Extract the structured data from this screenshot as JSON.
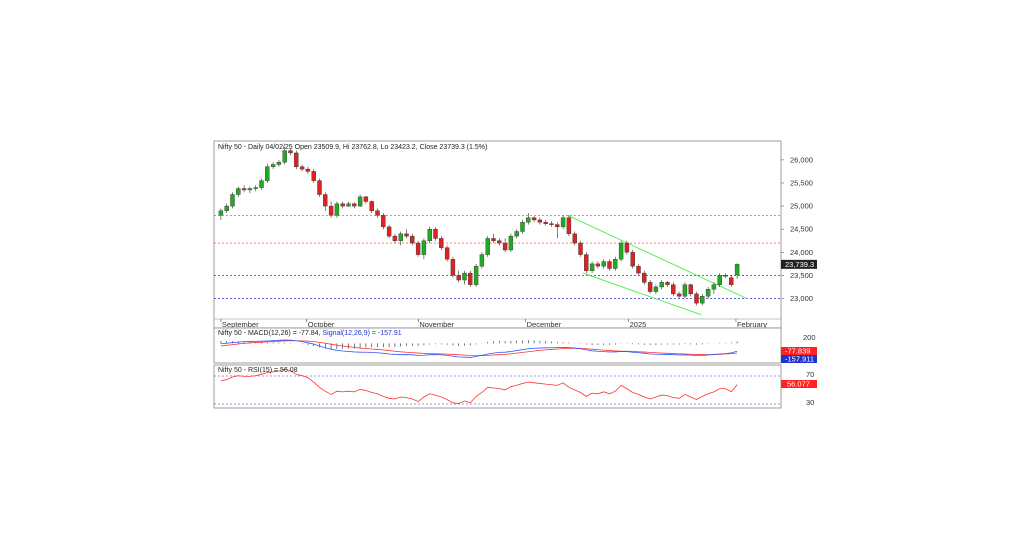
{
  "colors": {
    "up": "#22aa22",
    "down": "#dd2222",
    "channel": "#44ee44",
    "resistance": "#ff3333",
    "support": "#3333cc",
    "macd": "#3355ff",
    "signal": "#ff3333",
    "rsi": "#ff3333",
    "price_label_bg": "#222222",
    "macd_label_bg": "#ff2222",
    "signal_label_bg": "#2233cc"
  },
  "chart_data": [
    {
      "type": "candlestick",
      "title": "Nifty 50 - Daily 04/02/25 Open 23509.9, Hi 23762.8, Lo 23423.2, Close 23739.3 (1.5%)",
      "months": [
        {
          "label": "September",
          "index": 0
        },
        {
          "label": "October",
          "index": 20
        },
        {
          "label": "November",
          "index": 46
        },
        {
          "label": "December",
          "index": 71
        },
        {
          "label": "2025",
          "index": 95
        },
        {
          "label": "February",
          "index": 120
        }
      ],
      "ylim": [
        22600,
        26300
      ],
      "yticks": [
        23000,
        23500,
        24000,
        24500,
        25000,
        25500,
        26000
      ],
      "ytick_labels": [
        "23,000",
        "23,500",
        "24,000",
        "24,500",
        "25,000",
        "25,500",
        "26,000"
      ],
      "last_price_label": "23,739.3",
      "resistance_levels": [
        24800,
        24200
      ],
      "support_levels": [
        23500,
        23000
      ],
      "channel_lines": [
        {
          "x0": 91,
          "y0": 24800,
          "x1": 138,
          "y1": 23000
        },
        {
          "x0": 95,
          "y0": 23550,
          "x1": 126,
          "y1": 22650
        }
      ],
      "candles": [
        [
          24800,
          24950,
          24700,
          24900
        ],
        [
          24900,
          25050,
          24850,
          25000
        ],
        [
          25000,
          25300,
          24950,
          25250
        ],
        [
          25250,
          25420,
          25200,
          25380
        ],
        [
          25380,
          25450,
          25300,
          25350
        ],
        [
          25350,
          25420,
          25280,
          25380
        ],
        [
          25380,
          25450,
          25320,
          25400
        ],
        [
          25400,
          25600,
          25350,
          25550
        ],
        [
          25550,
          25920,
          25500,
          25850
        ],
        [
          25850,
          25950,
          25800,
          25900
        ],
        [
          25900,
          26000,
          25850,
          25950
        ],
        [
          25950,
          26280,
          25900,
          26200
        ],
        [
          26200,
          26250,
          26100,
          26150
        ],
        [
          26150,
          26200,
          25800,
          25850
        ],
        [
          25850,
          25900,
          25750,
          25800
        ],
        [
          25800,
          25850,
          25700,
          25750
        ],
        [
          25750,
          25800,
          25500,
          25550
        ],
        [
          25550,
          25600,
          25200,
          25250
        ],
        [
          25250,
          25300,
          24900,
          25000
        ],
        [
          25000,
          25100,
          24750,
          24800
        ],
        [
          24800,
          25100,
          24750,
          25050
        ],
        [
          25050,
          25100,
          24950,
          25000
        ],
        [
          25000,
          25100,
          24980,
          25050
        ],
        [
          25050,
          25080,
          24950,
          25000
        ],
        [
          25000,
          25250,
          24980,
          25200
        ],
        [
          25200,
          25220,
          25050,
          25100
        ],
        [
          25100,
          25120,
          24850,
          24900
        ],
        [
          24900,
          24950,
          24750,
          24800
        ],
        [
          24800,
          24850,
          24500,
          24550
        ],
        [
          24550,
          24600,
          24300,
          24350
        ],
        [
          24350,
          24400,
          24200,
          24250
        ],
        [
          24250,
          24450,
          24150,
          24400
        ],
        [
          24400,
          24500,
          24300,
          24350
        ],
        [
          24350,
          24400,
          24150,
          24200
        ],
        [
          24200,
          24250,
          23900,
          23950
        ],
        [
          23950,
          24300,
          23850,
          24250
        ],
        [
          24250,
          24550,
          24200,
          24500
        ],
        [
          24500,
          24550,
          24250,
          24300
        ],
        [
          24300,
          24350,
          24050,
          24100
        ],
        [
          24100,
          24150,
          23800,
          23850
        ],
        [
          23850,
          23900,
          23450,
          23500
        ],
        [
          23500,
          23600,
          23350,
          23400
        ],
        [
          23400,
          23600,
          23300,
          23550
        ],
        [
          23550,
          23600,
          23250,
          23300
        ],
        [
          23300,
          23750,
          23250,
          23700
        ],
        [
          23700,
          24000,
          23650,
          23950
        ],
        [
          23950,
          24350,
          23900,
          24300
        ],
        [
          24300,
          24400,
          24200,
          24250
        ],
        [
          24250,
          24300,
          24150,
          24200
        ],
        [
          24200,
          24300,
          24000,
          24050
        ],
        [
          24050,
          24400,
          24000,
          24350
        ],
        [
          24350,
          24500,
          24300,
          24450
        ],
        [
          24450,
          24700,
          24400,
          24650
        ],
        [
          24650,
          24850,
          24600,
          24750
        ],
        [
          24750,
          24780,
          24650,
          24700
        ],
        [
          24700,
          24750,
          24600,
          24650
        ],
        [
          24650,
          24700,
          24580,
          24620
        ],
        [
          24620,
          24680,
          24550,
          24600
        ],
        [
          24600,
          24650,
          24300,
          24550
        ],
        [
          24550,
          24800,
          24500,
          24750
        ],
        [
          24750,
          24800,
          24350,
          24400
        ],
        [
          24400,
          24450,
          24150,
          24200
        ],
        [
          24200,
          24250,
          23900,
          23950
        ],
        [
          23950,
          24000,
          23550,
          23600
        ],
        [
          23600,
          23800,
          23550,
          23750
        ],
        [
          23750,
          23800,
          23650,
          23700
        ],
        [
          23700,
          23850,
          23650,
          23800
        ],
        [
          23800,
          23850,
          23600,
          23650
        ],
        [
          23650,
          23900,
          23600,
          23850
        ],
        [
          23850,
          24250,
          23800,
          24200
        ],
        [
          24200,
          24250,
          23950,
          24000
        ],
        [
          24000,
          24050,
          23650,
          23700
        ],
        [
          23700,
          23750,
          23500,
          23550
        ],
        [
          23550,
          23600,
          23300,
          23350
        ],
        [
          23350,
          23400,
          23100,
          23150
        ],
        [
          23150,
          23300,
          23100,
          23250
        ],
        [
          23250,
          23400,
          23200,
          23350
        ],
        [
          23350,
          23380,
          23250,
          23300
        ],
        [
          23300,
          23350,
          23050,
          23100
        ],
        [
          23100,
          23150,
          23000,
          23050
        ],
        [
          23050,
          23350,
          23000,
          23300
        ],
        [
          23300,
          23320,
          23050,
          23100
        ],
        [
          23100,
          23150,
          22850,
          22900
        ],
        [
          22900,
          23100,
          22850,
          23050
        ],
        [
          23050,
          23250,
          23000,
          23200
        ],
        [
          23200,
          23350,
          23100,
          23300
        ],
        [
          23300,
          23550,
          23250,
          23500
        ],
        [
          23500,
          23550,
          23450,
          23500
        ],
        [
          23450,
          23500,
          23250,
          23300
        ],
        [
          23509.9,
          23762.8,
          23423.2,
          23739.3
        ]
      ],
      "x_count": 137
    },
    {
      "type": "line",
      "title_prefix": "Nifty 50 - ",
      "macd_text": "MACD(12,26) = -77.84,",
      "signal_text": "Signal(12,26,9) = -157.91",
      "ytick": "200",
      "macd_value_label": "-77.839",
      "signal_value_label": "-157.911",
      "ylim": [
        -550,
        500
      ],
      "macd": [
        250,
        270,
        300,
        320,
        340,
        350,
        355,
        360,
        370,
        385,
        400,
        410,
        405,
        380,
        340,
        290,
        230,
        150,
        70,
        10,
        -40,
        -70,
        -90,
        -110,
        -120,
        -125,
        -130,
        -145,
        -170,
        -200,
        -220,
        -230,
        -225,
        -235,
        -260,
        -255,
        -230,
        -225,
        -235,
        -260,
        -300,
        -330,
        -340,
        -350,
        -310,
        -260,
        -200,
        -160,
        -130,
        -120,
        -90,
        -50,
        -10,
        30,
        50,
        60,
        70,
        75,
        80,
        85,
        80,
        60,
        30,
        -20,
        -60,
        -80,
        -95,
        -110,
        -110,
        -90,
        -95,
        -120,
        -140,
        -170,
        -200,
        -210,
        -215,
        -220,
        -230,
        -240,
        -235,
        -250,
        -270,
        -265,
        -245,
        -220,
        -200,
        -185,
        -150,
        -77.84
      ],
      "signal": [
        150,
        180,
        210,
        240,
        265,
        285,
        300,
        315,
        330,
        345,
        360,
        375,
        380,
        380,
        375,
        360,
        340,
        310,
        270,
        230,
        190,
        150,
        120,
        90,
        60,
        40,
        20,
        0,
        -20,
        -50,
        -80,
        -105,
        -125,
        -140,
        -160,
        -175,
        -185,
        -190,
        -195,
        -205,
        -220,
        -235,
        -250,
        -265,
        -270,
        -270,
        -260,
        -245,
        -230,
        -210,
        -190,
        -160,
        -130,
        -100,
        -70,
        -40,
        -20,
        0,
        20,
        35,
        45,
        50,
        45,
        30,
        10,
        -10,
        -30,
        -50,
        -65,
        -75,
        -80,
        -90,
        -100,
        -115,
        -130,
        -145,
        -160,
        -170,
        -180,
        -190,
        -200,
        -210,
        -220,
        -225,
        -230,
        -225,
        -215,
        -200,
        -185,
        -157.91
      ],
      "histogram": [
        100,
        90,
        90,
        80,
        75,
        65,
        55,
        45,
        40,
        40,
        40,
        35,
        25,
        0,
        -35,
        -70,
        -110,
        -160,
        -200,
        -220,
        -230,
        -220,
        -210,
        -200,
        -180,
        -165,
        -150,
        -145,
        -150,
        -150,
        -140,
        -125,
        -100,
        -95,
        -100,
        -80,
        -45,
        -35,
        -40,
        -55,
        -80,
        -95,
        -90,
        -85,
        -40,
        10,
        60,
        85,
        100,
        90,
        100,
        110,
        120,
        130,
        120,
        100,
        90,
        75,
        60,
        50,
        35,
        10,
        -15,
        -50,
        -70,
        -70,
        -65,
        -60,
        -45,
        -15,
        -15,
        -30,
        -40,
        -55,
        -70,
        -65,
        -55,
        -50,
        -50,
        -50,
        -35,
        -40,
        -50,
        -40,
        -15,
        5,
        15,
        15,
        35,
        80
      ]
    },
    {
      "type": "line",
      "title_prefix": "Nifty 50 - ",
      "rsi_text": "RSI(15) = 56.08",
      "yticks": [
        70,
        30
      ],
      "rsi_value_label": "56.077",
      "ylim": [
        20,
        85
      ],
      "rsi": [
        62,
        64,
        68,
        70,
        69,
        69,
        70,
        72,
        75,
        76,
        77,
        80,
        78,
        72,
        70,
        67,
        60,
        52,
        46,
        41,
        46,
        45,
        46,
        45,
        49,
        47,
        44,
        42,
        38,
        35,
        34,
        37,
        36,
        34,
        30,
        37,
        42,
        40,
        37,
        33,
        28,
        27,
        31,
        28,
        38,
        44,
        52,
        51,
        50,
        48,
        53,
        55,
        58,
        60,
        59,
        58,
        57,
        56,
        55,
        59,
        52,
        48,
        44,
        38,
        43,
        42,
        45,
        42,
        46,
        55,
        50,
        44,
        41,
        37,
        34,
        37,
        40,
        39,
        36,
        35,
        41,
        37,
        33,
        38,
        42,
        45,
        50,
        50,
        45,
        56.08
      ]
    }
  ]
}
